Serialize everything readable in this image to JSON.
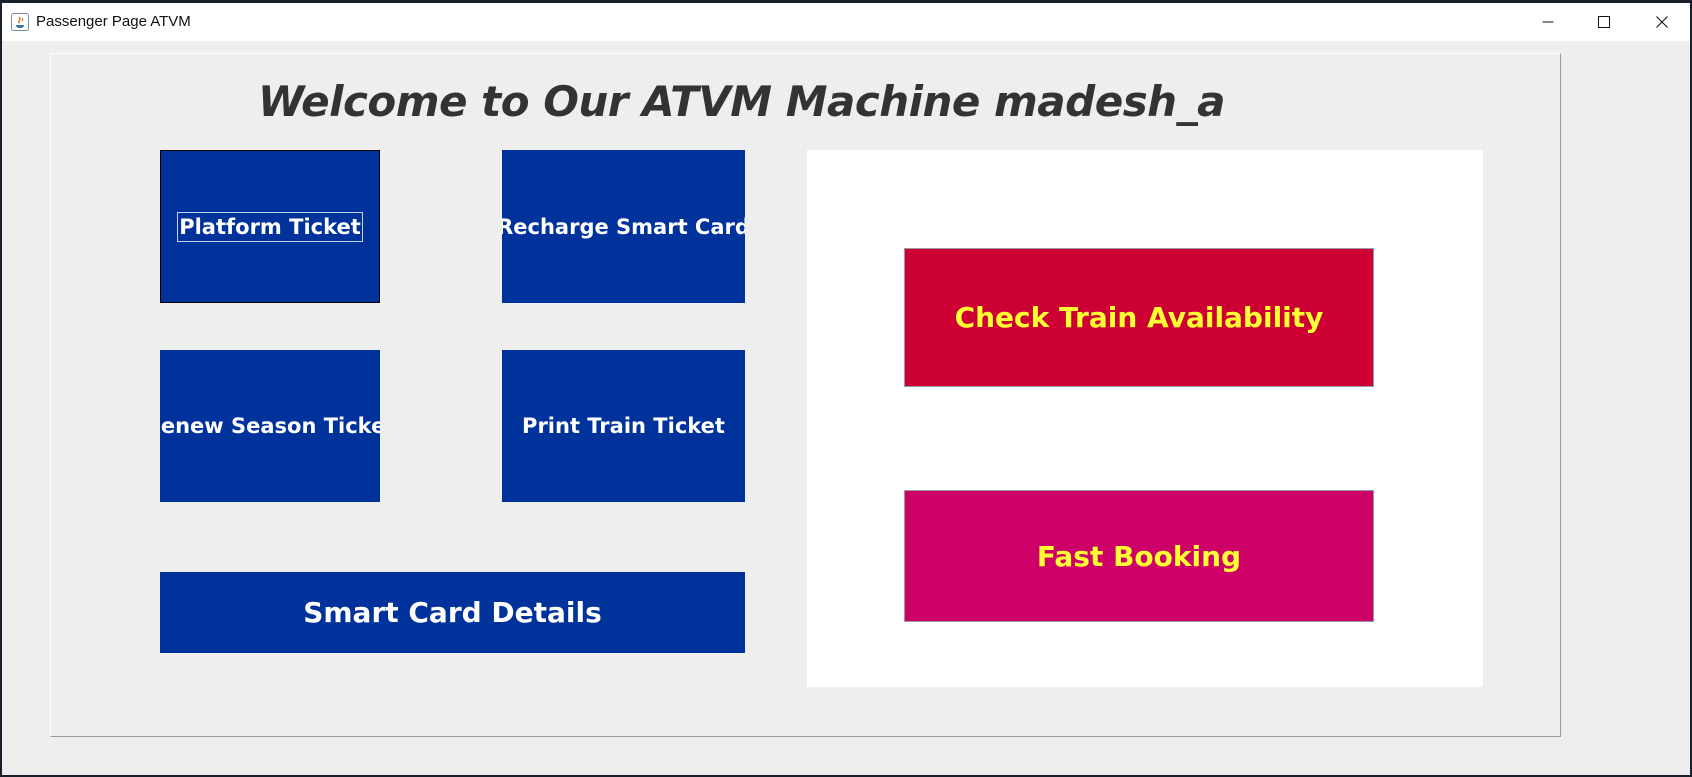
{
  "window": {
    "title": "Passenger Page ATVM",
    "controls": {
      "minimize_icon": "minimize-icon",
      "maximize_icon": "maximize-icon",
      "close_icon": "close-icon"
    }
  },
  "main": {
    "welcome": "Welcome to Our ATVM Machine madesh_a",
    "buttons": {
      "platform_ticket": "Platform Ticket",
      "recharge_smart_card": "Recharge Smart Card",
      "renew_season_ticket": "Renew Season Ticket",
      "print_train_ticket": "Print Train Ticket",
      "smart_card_details": "Smart Card Details",
      "check_train_availability": "Check Train Availability",
      "fast_booking": "Fast Booking"
    }
  },
  "colors": {
    "primary_blue": "#00329b",
    "check_red": "#cc0033",
    "fast_magenta": "#cc0066",
    "accent_yellow": "#ffff33",
    "title_text": "#333333"
  }
}
